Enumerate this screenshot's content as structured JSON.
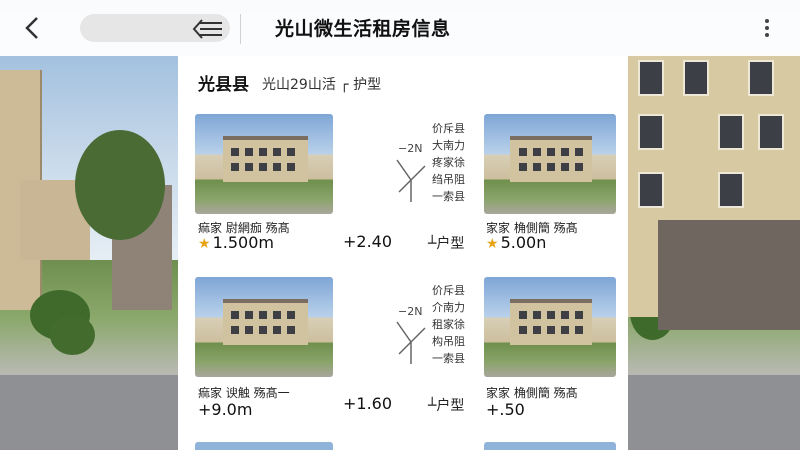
{
  "header": {
    "back_icon": "chevron-left-icon",
    "menu_icon": "hamburger-arrow-icon",
    "title": "光山微生活租房信息",
    "more_icon": "more-vertical-icon"
  },
  "section": {
    "title": "光县县",
    "subtitle": "光山29山活 ┌ 护型"
  },
  "listings": [
    {
      "caption": "痲家 尉網痂 殇髙",
      "price": "1.500m",
      "has_star": true,
      "mid_value": "+2.40",
      "type": "┴户型",
      "note_top": "−2N",
      "side_lines": [
        "价斥县",
        "大南力",
        "疼家徐",
        "绉吊阻",
        "一索县"
      ],
      "right_caption": "家家 桷側簡 殇髙",
      "right_price": "5.00n",
      "right_has_star": true
    },
    {
      "caption": "痲家 谀触 殇髙一",
      "price": "+9.0m",
      "has_star": false,
      "mid_value": "+1.60",
      "type": "┴户型",
      "note_top": "−2N",
      "side_lines": [
        "价斥县",
        "介南力",
        "租家徐",
        "构吊阻",
        "一索县"
      ],
      "right_caption": "家家 桷側簡 殇髙",
      "right_price": "+.50",
      "right_has_star": false
    }
  ],
  "colors": {
    "star": "#e8a317",
    "title_text": "#111111",
    "panel_bg": "#ffffff"
  }
}
